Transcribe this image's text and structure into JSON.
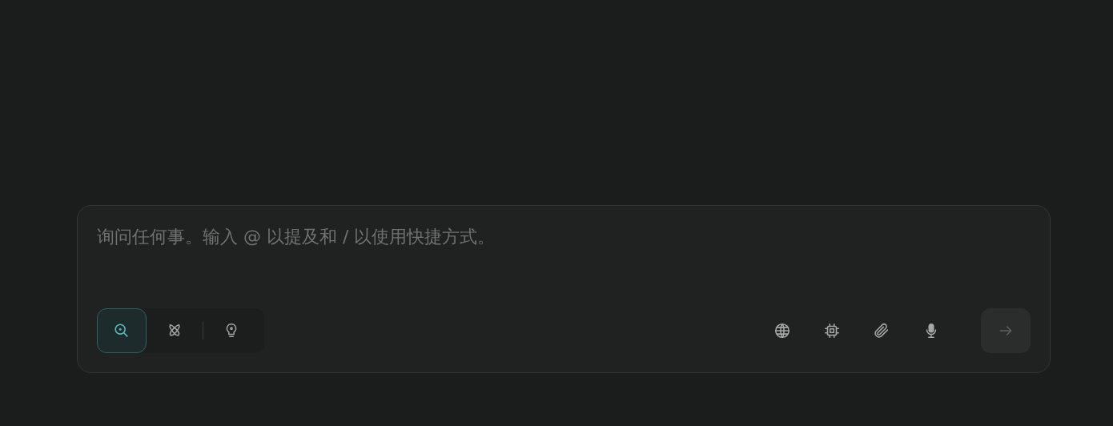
{
  "composer": {
    "placeholder": "询问任何事。输入 @ 以提及和 / 以使用快捷方式。",
    "modes": [
      {
        "kind": "search",
        "selected": true
      },
      {
        "kind": "atom",
        "selected": false
      },
      {
        "kind": "bulb",
        "selected": false
      }
    ],
    "tools": [
      {
        "kind": "globe"
      },
      {
        "kind": "chip"
      },
      {
        "kind": "clip"
      },
      {
        "kind": "mic"
      }
    ],
    "send": {
      "disabled": true
    }
  }
}
